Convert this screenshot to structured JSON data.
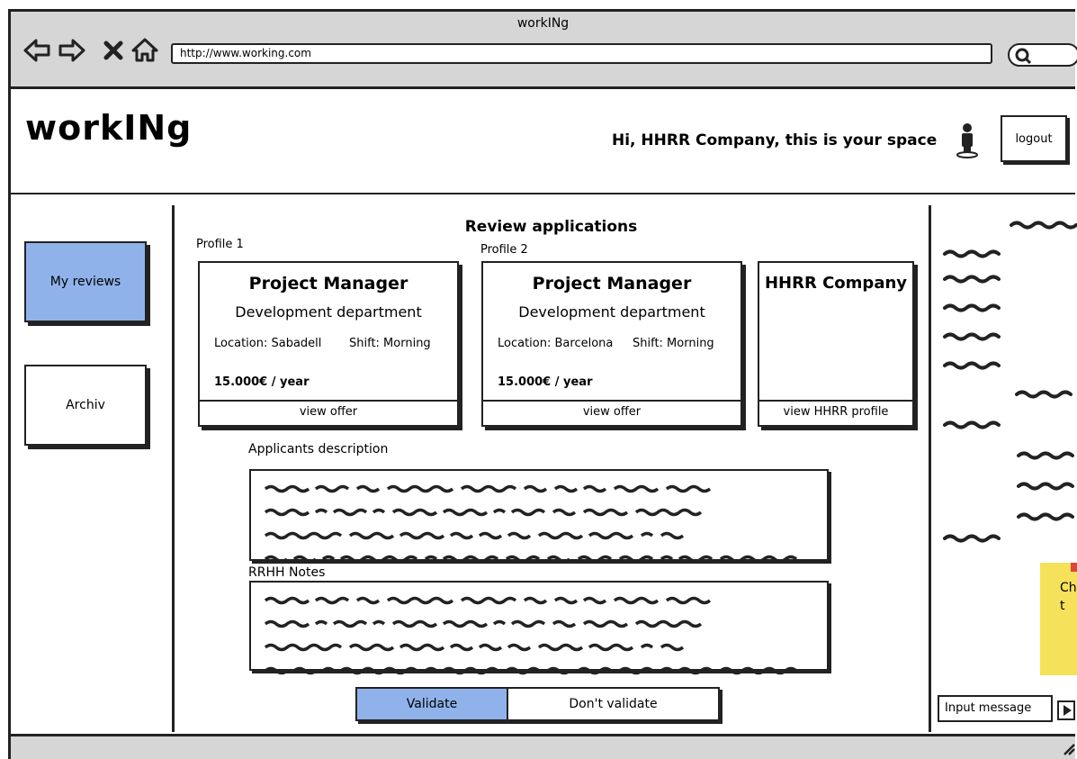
{
  "browser": {
    "title": "workINg",
    "url": "http://www.working.com"
  },
  "header": {
    "logo": "workINg",
    "greeting": "Hi, HHRR Company, this is your space",
    "logout_label": "logout"
  },
  "sidebar": {
    "items": [
      {
        "label": "My reviews",
        "active": true
      },
      {
        "label": "Archiv",
        "active": false
      }
    ]
  },
  "main": {
    "title": "Review applications",
    "profiles": [
      {
        "label": "Profile 1",
        "job_title": "Project Manager",
        "department": "Development department",
        "location": "Location: Sabadell",
        "shift": "Shift: Morning",
        "salary": "15.000€ / year",
        "action": "view offer"
      },
      {
        "label": "Profile 2",
        "job_title": "Project Manager",
        "department": "Development department",
        "location": "Location: Barcelona",
        "shift": "Shift: Morning",
        "salary": "15.000€ / year",
        "action": "view offer"
      }
    ],
    "company_card": {
      "name": "HHRR Company",
      "action": "view HHRR profile"
    },
    "applicants_label": "Applicants description",
    "notes_label": "RRHH Notes",
    "validate_label": "Validate",
    "dont_validate_label": "Don't validate"
  },
  "chat": {
    "input_placeholder": "Input message",
    "sticky_text": "Ch t"
  },
  "colors": {
    "accent": "#8fb2ea",
    "chrome": "#d6d6d6",
    "sticky": "#f5e15a"
  }
}
